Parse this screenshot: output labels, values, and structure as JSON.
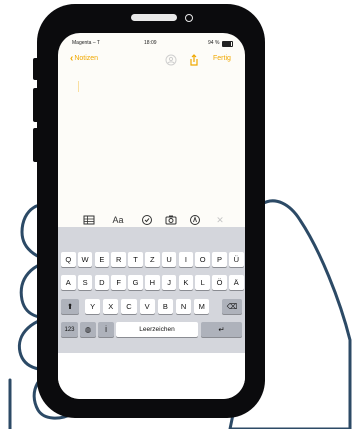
{
  "status_bar": {
    "carrier": "Magenta – T",
    "time": "18:09",
    "battery": "94 %"
  },
  "nav": {
    "back_label": "Notizen",
    "done_label": "Fertig"
  },
  "toolbar": {
    "items": [
      {
        "name": "table-icon",
        "glyph": "⊞"
      },
      {
        "name": "format-text-icon",
        "glyph": "Aa"
      },
      {
        "name": "checklist-icon",
        "glyph": "✓"
      },
      {
        "name": "camera-icon",
        "glyph": "▣"
      },
      {
        "name": "markup-pen-icon",
        "glyph": "Ⓐ"
      },
      {
        "name": "close-icon",
        "glyph": "✕"
      }
    ]
  },
  "keyboard": {
    "row1": [
      "Q",
      "W",
      "E",
      "R",
      "T",
      "Z",
      "U",
      "I",
      "O",
      "P",
      "Ü"
    ],
    "row2": [
      "A",
      "S",
      "D",
      "F",
      "G",
      "H",
      "J",
      "K",
      "L",
      "Ö",
      "Ä"
    ],
    "row3": [
      "Y",
      "X",
      "C",
      "V",
      "B",
      "N",
      "M"
    ],
    "shift_glyph": "⬆",
    "delete_glyph": "⌫",
    "numbers_label": "123",
    "globe_glyph": "◍",
    "mic_glyph": "İ",
    "space_label": "Leerzeichen",
    "return_glyph": "↵"
  },
  "colors": {
    "accent": "#f0a800",
    "hand_stroke": "#2c4a66",
    "phone": "#0b0b0d",
    "keyboard_bg": "#d4d6dc"
  }
}
